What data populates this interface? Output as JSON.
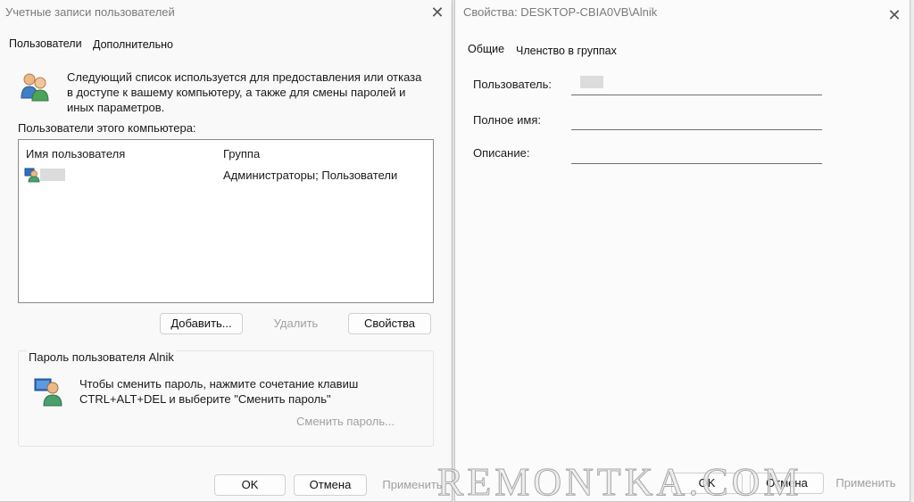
{
  "left_dialog": {
    "title": "Учетные записи пользователей",
    "tabs": [
      "Пользователи",
      "Дополнительно"
    ],
    "description_line1": "Следующий список используется для предоставления или отказа",
    "description_line2": "в доступе к вашему компьютеру, а также для смены паролей и",
    "description_line3": "иных параметров.",
    "list_label": "Пользователи этого компьютера:",
    "columns": [
      "Имя пользователя",
      "Группа"
    ],
    "rows": [
      {
        "name": "",
        "group": "Администраторы; Пользователи"
      }
    ],
    "buttons": {
      "add": "Добавить...",
      "remove": "Удалить",
      "properties": "Свойства"
    },
    "password_group_title": "Пароль пользователя Alnik",
    "password_text_line1": "Чтобы сменить пароль, нажмите сочетание клавиш",
    "password_text_line2": "CTRL+ALT+DEL и выберите \"Сменить пароль\"",
    "change_password": "Сменить пароль...",
    "footer": {
      "ok": "OK",
      "cancel": "Отмена",
      "apply": "Применить"
    }
  },
  "right_dialog": {
    "title": "Свойства: DESKTOP-CBIA0VB\\Alnik",
    "tabs": [
      "Общие",
      "Членство в группах"
    ],
    "fields": {
      "username_label": "Пользователь:",
      "fullname_label": "Полное имя:",
      "description_label": "Описание:"
    },
    "footer": {
      "ok": "OK",
      "cancel": "Отмена",
      "apply": "Применить"
    }
  },
  "icons": {
    "close": "close-icon",
    "users": "users-icon",
    "user_row": "user-account-icon",
    "password": "user-password-icon"
  },
  "watermark": "REMONTKA.COM"
}
